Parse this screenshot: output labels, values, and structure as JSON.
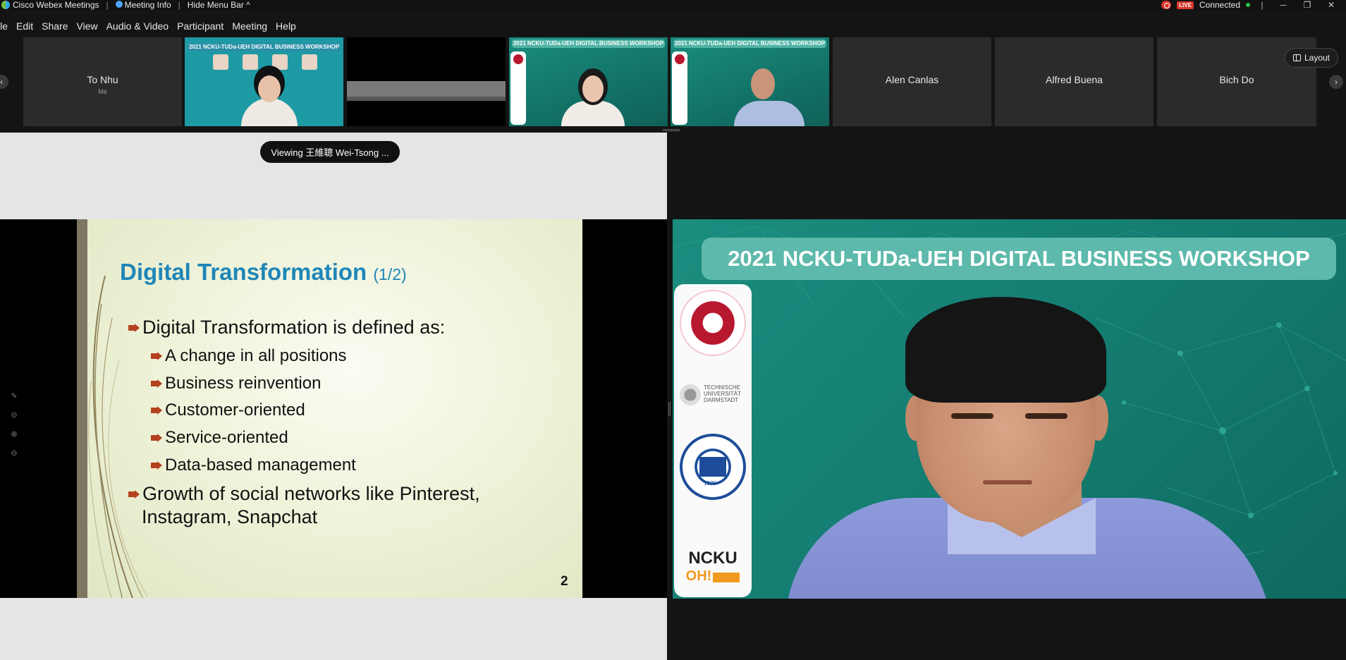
{
  "titlebar": {
    "app_name": "Cisco Webex Meetings",
    "meeting_info": "Meeting Info",
    "hide_menu": "Hide Menu Bar ^",
    "live": "LIVE",
    "status": "Connected",
    "minimize": "─",
    "restore": "❐",
    "close": "✕"
  },
  "menu": {
    "file": "ile",
    "edit": "Edit",
    "share": "Share",
    "view": "View",
    "audio_video": "Audio & Video",
    "participant": "Participant",
    "meeting": "Meeting",
    "help": "Help"
  },
  "participants": [
    {
      "name": "To Nhu",
      "sub": "Me"
    },
    {
      "name": "Alen Canlas"
    },
    {
      "name": "Alfred Buena"
    },
    {
      "name": "Bich Do"
    }
  ],
  "thumb_banner": "2021 NCKU-TUDa-UEH DIGITAL BUSINESS WORKSHOP",
  "thumb_banner_small": "2021 NCKU-TUDa-UEH DIGITAL BUSINESS WORKSHOP",
  "layout_button": "Layout",
  "viewing": "Viewing 王維聰 Wei-Tsong ...",
  "slide": {
    "title": "Digital Transformation",
    "title_sub": "(1/2)",
    "bullets": [
      "Digital Transformation is defined as:",
      "A change in all positions",
      "Business reinvention",
      "Customer-oriented",
      "Service-oriented",
      "Data-based management",
      "Growth of social networks like Pinterest,",
      "Instagram, Snapchat"
    ],
    "number": "2"
  },
  "speaker": {
    "banner": "2021 NCKU-TUDa-UEH DIGITAL BUSINESS WORKSHOP",
    "tud_logo": "TECHNISCHE UNIVERSITÄT DARMSTADT",
    "ueh_logo": "1976",
    "ncku_logo": "NCKU",
    "oh_logo": "OH!"
  },
  "colors": {
    "title_blue": "#1f86b8",
    "bullet_red": "#b5411e",
    "banner_teal": "#5db9ab",
    "background_green": "#168074"
  }
}
